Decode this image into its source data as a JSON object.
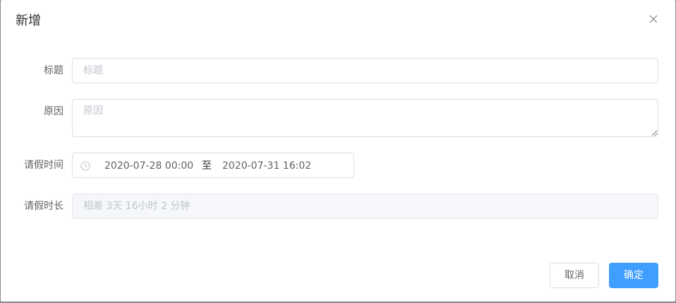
{
  "dialog": {
    "title": "新增",
    "close_icon": "close-icon"
  },
  "form": {
    "title_field": {
      "label": "标题",
      "value": "",
      "placeholder": "标题"
    },
    "reason_field": {
      "label": "原因",
      "value": "",
      "placeholder": "原因"
    },
    "leave_time": {
      "label": "请假时间",
      "icon": "clock-icon",
      "start": "2020-07-28 00:00",
      "separator": "至",
      "end": "2020-07-31 16:02"
    },
    "leave_duration": {
      "label": "请假时长",
      "value": "",
      "placeholder": "相差 3天 16小时 2 分钟"
    }
  },
  "footer": {
    "cancel_label": "取消",
    "confirm_label": "确定"
  },
  "colors": {
    "primary": "#409eff",
    "border": "#dcdfe6",
    "text": "#606266",
    "placeholder": "#c0c4cc"
  }
}
